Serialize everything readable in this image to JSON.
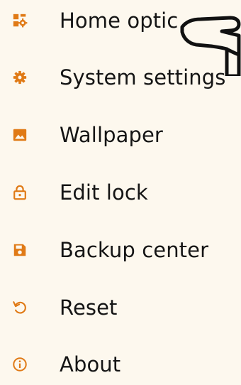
{
  "menu": {
    "accent_color": "#e07a16",
    "items": [
      {
        "label": "Home optic",
        "icon": "home-settings-icon"
      },
      {
        "label": "System settings",
        "icon": "gear-icon"
      },
      {
        "label": "Wallpaper",
        "icon": "image-icon"
      },
      {
        "label": "Edit lock",
        "icon": "lock-icon"
      },
      {
        "label": "Backup center",
        "icon": "save-icon"
      },
      {
        "label": "Reset",
        "icon": "reset-icon"
      },
      {
        "label": "About",
        "icon": "info-icon"
      }
    ]
  },
  "overlay": {
    "hand_pointer": "hand-pointer-icon"
  }
}
